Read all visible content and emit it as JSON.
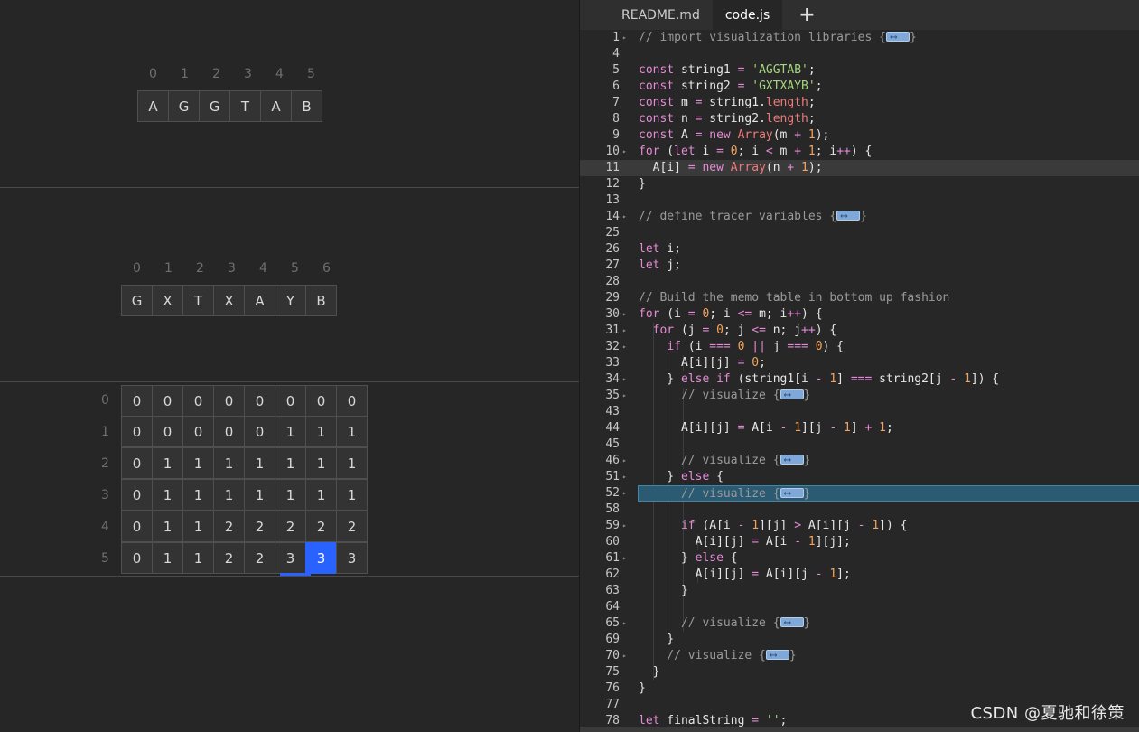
{
  "left": {
    "string1_tracer": {
      "indices": [
        "0",
        "1",
        "2",
        "3",
        "4",
        "5"
      ],
      "values": [
        "A",
        "G",
        "G",
        "T",
        "A",
        "B"
      ]
    },
    "string2_tracer": {
      "indices": [
        "0",
        "1",
        "2",
        "3",
        "4",
        "5",
        "6"
      ],
      "values": [
        "G",
        "X",
        "T",
        "X",
        "A",
        "Y",
        "B"
      ]
    },
    "memo_table": {
      "row_indices": [
        "0",
        "1",
        "2",
        "3",
        "4",
        "5"
      ],
      "rows": [
        [
          "0",
          "0",
          "0",
          "0",
          "0",
          "0",
          "0",
          "0"
        ],
        [
          "0",
          "0",
          "0",
          "0",
          "0",
          "1",
          "1",
          "1"
        ],
        [
          "0",
          "1",
          "1",
          "1",
          "1",
          "1",
          "1",
          "1"
        ],
        [
          "0",
          "1",
          "1",
          "1",
          "1",
          "1",
          "1",
          "1"
        ],
        [
          "0",
          "1",
          "1",
          "2",
          "2",
          "2",
          "2",
          "2"
        ],
        [
          "0",
          "1",
          "1",
          "2",
          "2",
          "3",
          "3",
          "3"
        ]
      ],
      "highlighted_cell": {
        "row": 5,
        "col": 6
      }
    }
  },
  "tabs": [
    {
      "label": "README.md",
      "active": false
    },
    {
      "label": "code.js",
      "active": true
    }
  ],
  "add_tab_label": "+",
  "editor": {
    "active_line": "11",
    "lines": [
      {
        "n": "1",
        "fold": true,
        "text": "// import visualization libraries {",
        "marker": true,
        "after": "}",
        "cmt": true,
        "indent": 0
      },
      {
        "n": "4",
        "text": "",
        "indent": 0
      },
      {
        "n": "5",
        "text": "const string1 = 'AGGTAB';",
        "indent": 0
      },
      {
        "n": "6",
        "text": "const string2 = 'GXTXAYB';",
        "indent": 0
      },
      {
        "n": "7",
        "text": "const m = string1.length;",
        "indent": 0
      },
      {
        "n": "8",
        "text": "const n = string2.length;",
        "indent": 0
      },
      {
        "n": "9",
        "text": "const A = new Array(m + 1);",
        "indent": 0
      },
      {
        "n": "10",
        "fold": true,
        "text": "for (let i = 0; i < m + 1; i++) {",
        "indent": 0
      },
      {
        "n": "11",
        "text": "  A[i] = new Array(n + 1);",
        "indent": 0
      },
      {
        "n": "12",
        "text": "}",
        "indent": 0
      },
      {
        "n": "13",
        "text": "",
        "indent": 0
      },
      {
        "n": "14",
        "fold": true,
        "text": "// define tracer variables {",
        "marker": true,
        "after": "}",
        "cmt": true,
        "indent": 0
      },
      {
        "n": "25",
        "text": "",
        "indent": 0
      },
      {
        "n": "26",
        "text": "let i;",
        "indent": 0
      },
      {
        "n": "27",
        "text": "let j;",
        "indent": 0
      },
      {
        "n": "28",
        "text": "",
        "indent": 0
      },
      {
        "n": "29",
        "text": "// Build the memo table in bottom up fashion",
        "cmt": true,
        "indent": 0
      },
      {
        "n": "30",
        "fold": true,
        "text": "for (i = 0; i <= m; i++) {",
        "indent": 0
      },
      {
        "n": "31",
        "fold": true,
        "text": "  for (j = 0; j <= n; j++) {",
        "indent": 1
      },
      {
        "n": "32",
        "fold": true,
        "text": "    if (i === 0 || j === 0) {",
        "indent": 2
      },
      {
        "n": "33",
        "text": "      A[i][j] = 0;",
        "indent": 3
      },
      {
        "n": "34",
        "fold": true,
        "text": "    } else if (string1[i - 1] === string2[j - 1]) {",
        "indent": 2
      },
      {
        "n": "35",
        "fold": true,
        "text": "      // visualize {",
        "marker": true,
        "after": "}",
        "cmt": true,
        "indent": 3
      },
      {
        "n": "43",
        "text": "",
        "indent": 3
      },
      {
        "n": "44",
        "text": "      A[i][j] = A[i - 1][j - 1] + 1;",
        "indent": 3
      },
      {
        "n": "45",
        "text": "",
        "indent": 3
      },
      {
        "n": "46",
        "fold": true,
        "text": "      // visualize {",
        "marker": true,
        "after": "}",
        "cmt": true,
        "indent": 3
      },
      {
        "n": "51",
        "fold": true,
        "text": "    } else {",
        "indent": 2
      },
      {
        "n": "52",
        "fold": true,
        "text": "      // visualize {",
        "marker": true,
        "after": "}",
        "cmt": true,
        "indent": 3,
        "selected": true
      },
      {
        "n": "58",
        "text": "",
        "indent": 3
      },
      {
        "n": "59",
        "fold": true,
        "text": "      if (A[i - 1][j] > A[i][j - 1]) {",
        "indent": 3
      },
      {
        "n": "60",
        "text": "        A[i][j] = A[i - 1][j];",
        "indent": 4
      },
      {
        "n": "61",
        "fold": true,
        "text": "      } else {",
        "indent": 3
      },
      {
        "n": "62",
        "text": "        A[i][j] = A[i][j - 1];",
        "indent": 4
      },
      {
        "n": "63",
        "text": "      }",
        "indent": 3
      },
      {
        "n": "64",
        "text": "",
        "indent": 3
      },
      {
        "n": "65",
        "fold": true,
        "text": "      // visualize {",
        "marker": true,
        "after": "}",
        "cmt": true,
        "indent": 3
      },
      {
        "n": "69",
        "text": "    }",
        "indent": 2
      },
      {
        "n": "70",
        "fold": true,
        "text": "    // visualize {",
        "marker": true,
        "after": "}",
        "cmt": true,
        "indent": 2
      },
      {
        "n": "75",
        "text": "  }",
        "indent": 1
      },
      {
        "n": "76",
        "text": "}",
        "indent": 0
      },
      {
        "n": "77",
        "text": "",
        "indent": 0
      },
      {
        "n": "78",
        "text": "let finalString = '';",
        "indent": 0
      }
    ]
  },
  "watermark": "CSDN @夏驰和徐策"
}
